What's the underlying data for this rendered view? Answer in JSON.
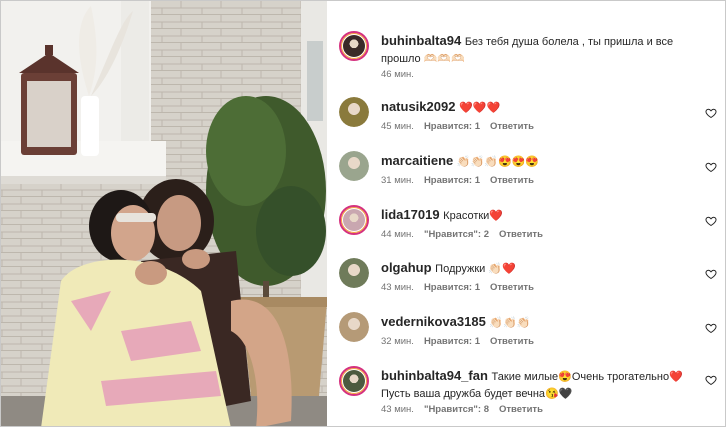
{
  "comments": [
    {
      "user": "buhinbalta94",
      "text": "Без тебя душа болела , ты пришла и все прошло 🫶🏻🫶🏻🫶🏻",
      "time": "46 мин.",
      "likes": "",
      "reply": "",
      "avatar_color": "#3a2a28",
      "story_ring": true,
      "has_heart": false
    },
    {
      "user": "natusik2092",
      "text": "❤️❤️❤️",
      "time": "45 мин.",
      "likes": "Нравится: 1",
      "reply": "Ответить",
      "avatar_color": "#8a7a3c",
      "story_ring": false,
      "has_heart": true
    },
    {
      "user": "marcaitiene",
      "text": "👏🏻👏🏻👏🏻😍😍😍",
      "time": "31 мин.",
      "likes": "Нравится: 1",
      "reply": "Ответить",
      "avatar_color": "#9aa58e",
      "story_ring": false,
      "has_heart": true
    },
    {
      "user": "lida17019",
      "text": "Красотки❤️",
      "time": "44 мин.",
      "likes": "\"Нравится\": 2",
      "reply": "Ответить",
      "avatar_color": "#c9a7b0",
      "story_ring": true,
      "has_heart": true
    },
    {
      "user": "olgahup",
      "text": "Подружки 👏🏻❤️",
      "time": "43 мин.",
      "likes": "Нравится: 1",
      "reply": "Ответить",
      "avatar_color": "#6f7b5a",
      "story_ring": false,
      "has_heart": true
    },
    {
      "user": "vedernikova3185",
      "text": "👏🏻👏🏻👏🏻",
      "time": "32 мин.",
      "likes": "Нравится: 1",
      "reply": "Ответить",
      "avatar_color": "#b59a77",
      "story_ring": false,
      "has_heart": true
    },
    {
      "user": "buhinbalta94_fan",
      "text": "Такие милые😍Очень трогательно❤️ Пусть ваша дружба будет вечна😘🖤",
      "time": "43 мин.",
      "likes": "\"Нравится\": 8",
      "reply": "Ответить",
      "avatar_color": "#4d5a3f",
      "story_ring": true,
      "has_heart": true
    }
  ],
  "colors": {
    "heart_red": "#c0182a",
    "meta_gray": "#737373",
    "ring": "#d4317f"
  },
  "icons": {
    "like": "heart-outline-icon"
  }
}
